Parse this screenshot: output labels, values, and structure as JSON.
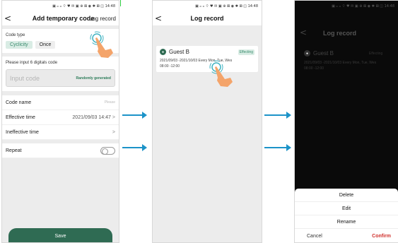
{
  "status_bar": "▣ ᵢₗₗ ᵢₗₗ ⌔ ♥ ✉ ▣ ⊕ ⊠ ◉ ✱ ⊠ ◫ 14:48",
  "screen1": {
    "title": "Add temporary code",
    "log_record_link": "Log record",
    "code_type_label": "Code type",
    "code_types": [
      "Cyclicity",
      "Once"
    ],
    "code_input_label": "Please input 6 digitals code",
    "code_input_placeholder": "Input code",
    "randomly_generated": "Randomly generated",
    "code_name_label": "Code name",
    "code_name_placeholder": "Please",
    "effective_time_label": "Effective time",
    "effective_time_value": "2021/09/03 14:47",
    "ineffective_time_label": "Ineffective time",
    "repeat_label": "Repeat",
    "save_label": "Save"
  },
  "screen2": {
    "title": "Log record",
    "guest_name": "Guest B",
    "badge": "Effecting",
    "line1": "2021/09/03 -2021/10/03 Every Mon, Tue, Wes",
    "line2": "08:00 -12:00"
  },
  "screen3": {
    "title": "Log record",
    "guest_name": "Guest B",
    "badge": "Effecting",
    "line1": "2021/09/03 -2021/10/03 Every Mon, Tue, Wes",
    "line2": "08:00 -12:00",
    "options": [
      "Delete",
      "Edit",
      "Rename"
    ],
    "cancel_label": "Cancel",
    "confirm_label": "Confirm"
  },
  "icons": {
    "back": "chevron-left-icon",
    "chevron": "chevron-right-icon",
    "hand": "hand-pointer-icon",
    "arrow": "right-arrow-icon"
  },
  "colors": {
    "accent": "#2f6b53",
    "arrow": "#1c93c8",
    "confirm": "#d0312d"
  }
}
